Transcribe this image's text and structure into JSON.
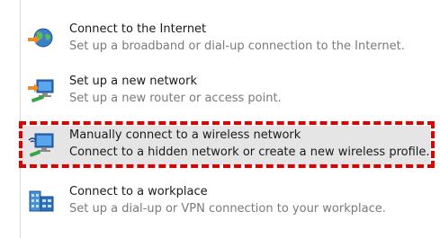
{
  "options": [
    {
      "title": "Connect to the Internet",
      "description": "Set up a broadband or dial-up connection to the Internet.",
      "icon": "globe-network-icon"
    },
    {
      "title": "Set up a new network",
      "description": "Set up a new router or access point.",
      "icon": "router-network-icon"
    },
    {
      "title": "Manually connect to a wireless network",
      "description": "Connect to a hidden network or create a new wireless profile.",
      "icon": "wireless-monitor-icon"
    },
    {
      "title": "Connect to a workplace",
      "description": "Set up a dial-up or VPN connection to your workplace.",
      "icon": "workplace-building-icon"
    }
  ],
  "selected_index": 2,
  "colors": {
    "highlight": "#e00000",
    "selected_background": "#e5e5e5",
    "title_text": "#1a1a1a",
    "description_text": "#7a7a7a"
  }
}
